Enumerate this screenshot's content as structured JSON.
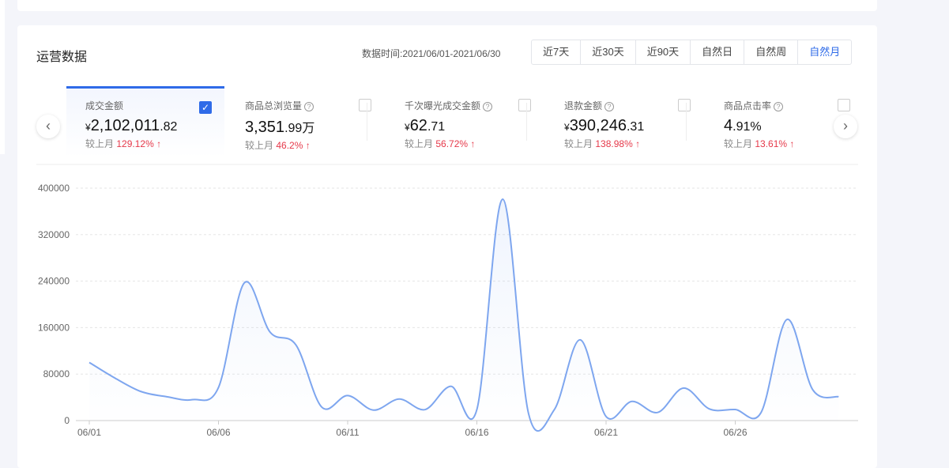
{
  "header": {
    "title": "运营数据",
    "date_label": "数据时间:",
    "date_range": "2021/06/01-2021/06/30",
    "tabs": [
      {
        "label": "近7天"
      },
      {
        "label": "近30天"
      },
      {
        "label": "近90天"
      },
      {
        "label": "自然日"
      },
      {
        "label": "自然周"
      },
      {
        "label": "自然月",
        "active": true
      }
    ]
  },
  "metrics": [
    {
      "label": "成交金额",
      "currency": "¥",
      "int": "2,102,011",
      "dec": ".82",
      "unit": "",
      "compare": "较上月",
      "pct": "129.12%",
      "checked": true,
      "help": false
    },
    {
      "label": "商品总浏览量",
      "currency": "",
      "int": "3,351",
      "dec": ".99",
      "unit": "万",
      "compare": "较上月",
      "pct": "46.2%",
      "checked": false,
      "help": true
    },
    {
      "label": "千次曝光成交金额",
      "currency": "¥",
      "int": "62",
      "dec": ".71",
      "unit": "",
      "compare": "较上月",
      "pct": "56.72%",
      "checked": false,
      "help": true
    },
    {
      "label": "退款金额",
      "currency": "¥",
      "int": "390,246",
      "dec": ".31",
      "unit": "",
      "compare": "较上月",
      "pct": "138.98%",
      "checked": false,
      "help": true
    },
    {
      "label": "商品点击率",
      "currency": "",
      "int": "4",
      "dec": ".91",
      "unit": "%",
      "compare": "较上月",
      "pct": "13.61%",
      "checked": false,
      "help": true
    }
  ],
  "icons": {
    "prev": "chevron-left-icon",
    "next": "chevron-right-icon",
    "up": "arrow-up-icon",
    "help": "question-circle-icon"
  },
  "colors": {
    "accent": "#2f6be8",
    "up": "#e6394a",
    "line": "#7ea6ef"
  },
  "chart_data": {
    "type": "line",
    "x": [
      "06/01",
      "06/02",
      "06/03",
      "06/04",
      "06/05",
      "06/06",
      "06/07",
      "06/08",
      "06/09",
      "06/10",
      "06/11",
      "06/12",
      "06/13",
      "06/14",
      "06/15",
      "06/16",
      "06/17",
      "06/18",
      "06/19",
      "06/20",
      "06/21",
      "06/22",
      "06/23",
      "06/24",
      "06/25",
      "06/26",
      "06/27",
      "06/28",
      "06/29",
      "06/30"
    ],
    "xticks": [
      "06/01",
      "06/06",
      "06/11",
      "06/16",
      "06/21",
      "06/26"
    ],
    "yticks": [
      0,
      80000,
      160000,
      240000,
      320000,
      400000
    ],
    "ylim": [
      0,
      400000
    ],
    "series": [
      {
        "name": "成交金额",
        "values": [
          100000,
          73000,
          50000,
          41000,
          36000,
          57000,
          237000,
          152000,
          130000,
          23000,
          43000,
          18000,
          37000,
          19000,
          59000,
          19000,
          381000,
          12000,
          19000,
          139000,
          7000,
          33000,
          14000,
          56000,
          20000,
          19000,
          14000,
          174000,
          53000,
          41000
        ]
      }
    ]
  }
}
